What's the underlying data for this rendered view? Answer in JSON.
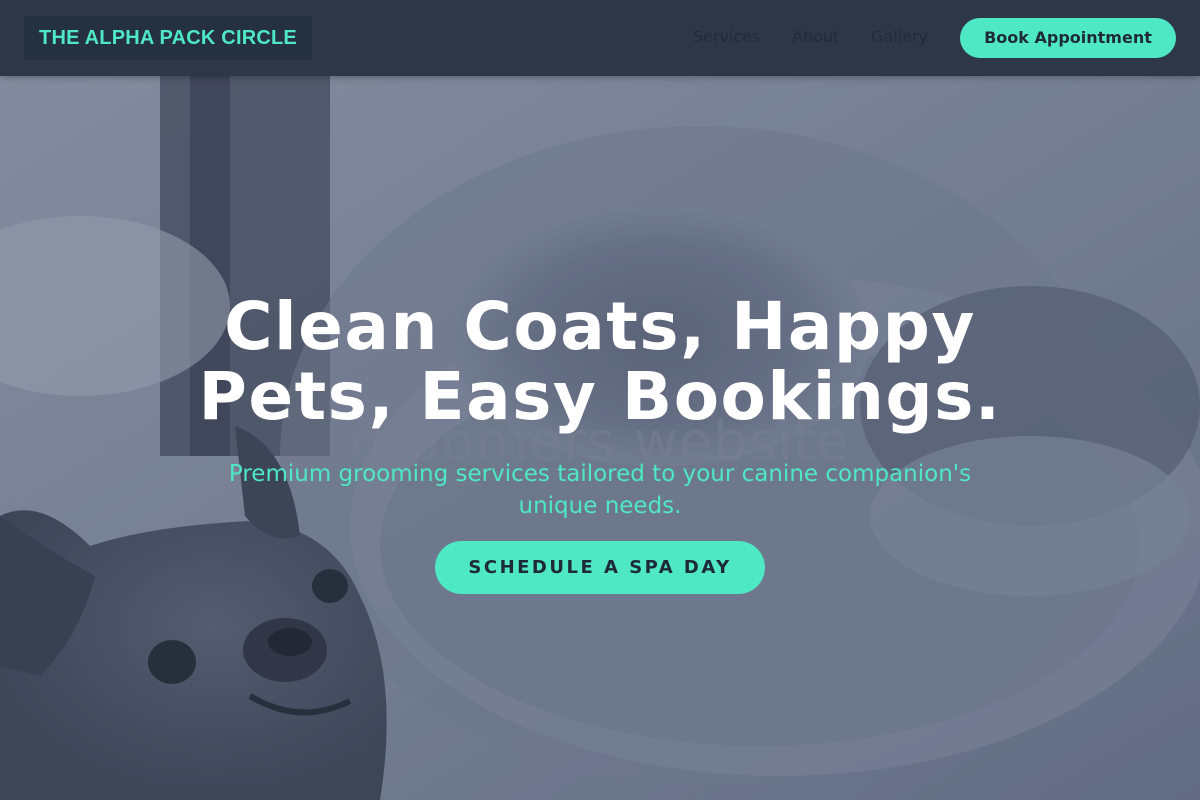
{
  "header": {
    "logo": "THE ALPHA PACK CIRCLE",
    "nav": [
      {
        "label": "Services"
      },
      {
        "label": "About"
      },
      {
        "label": "Gallery"
      }
    ],
    "book_button": "Book Appointment"
  },
  "hero": {
    "headline_line1": "Clean Coats, Happy",
    "headline_line2": "Pets, Easy Bookings.",
    "watermark": "groomers.website",
    "subtext_line1": "Premium grooming services tailored to your canine companion's",
    "subtext_line2": "unique needs.",
    "cta_button": "SCHEDULE A SPA DAY",
    "background_icon": "dog-photo-icon"
  },
  "colors": {
    "accent": "#4ee8c4",
    "header_bg": "#2d3748",
    "headline": "#ffffff",
    "button_text": "#1f2a38"
  }
}
